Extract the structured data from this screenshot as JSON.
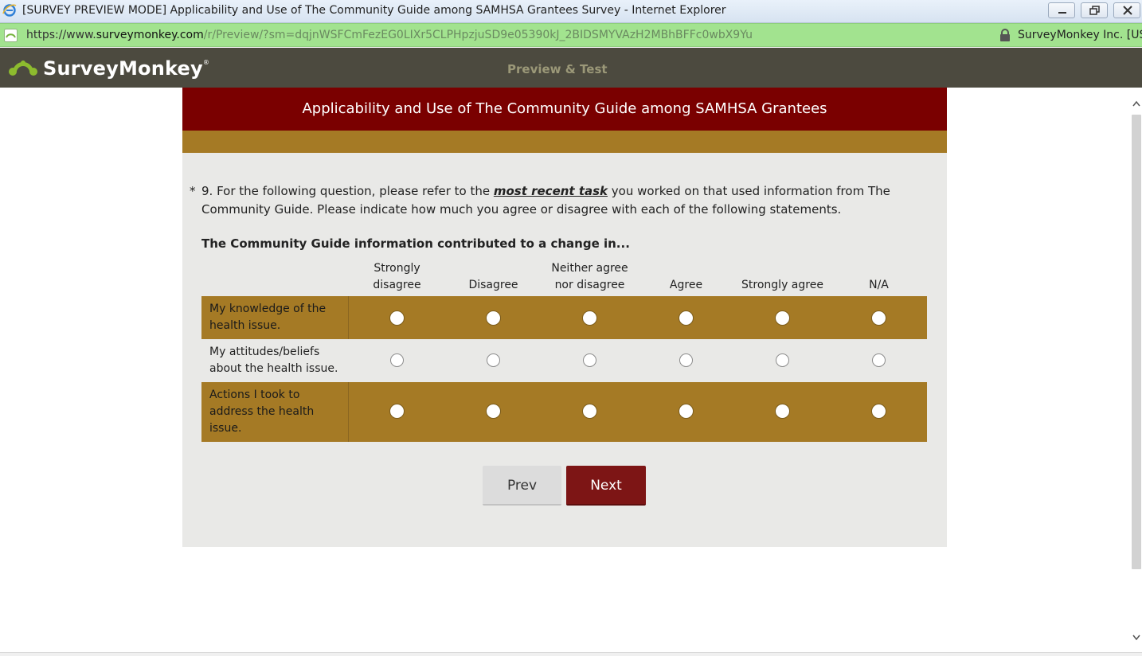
{
  "window": {
    "title": "[SURVEY PREVIEW MODE] Applicability and Use of The Community Guide among SAMHSA Grantees Survey - Internet Explorer"
  },
  "address_bar": {
    "url_scheme": "https://www.",
    "url_host": "surveymonkey.com",
    "url_rest": "/r/Preview/?sm=dqjnWSFCmFezEG0LIXr5CLPHpzjuSD9e05390kJ_2BIDSMYVAzH2MBhBFFc0wbX9Yu",
    "certificate": "SurveyMonkey Inc. [US]"
  },
  "header": {
    "brand": "SurveyMonkey",
    "brand_mark": "®",
    "mode_label": "Preview & Test"
  },
  "survey": {
    "title": "Applicability and Use of The Community Guide among SAMHSA Grantees",
    "question": {
      "required_marker": "*",
      "text_before": "9. For the following question, please refer to the ",
      "emphasis": "most recent task",
      "text_after": " you worked on that used information from The Community Guide. Please indicate how much you agree or disagree with each of the following statements."
    },
    "matrix": {
      "heading": "The Community Guide information contributed to a change in...",
      "columns": [
        "Strongly disagree",
        "Disagree",
        "Neither agree nor disagree",
        "Agree",
        "Strongly agree",
        "N/A"
      ],
      "rows": [
        {
          "label": "My knowledge of the health issue."
        },
        {
          "label": "My attitudes/beliefs about the health issue."
        },
        {
          "label": "Actions I took to address the health issue."
        }
      ]
    },
    "buttons": {
      "prev": "Prev",
      "next": "Next"
    }
  },
  "colors": {
    "title_bg": "#7a0000",
    "accent_band": "#a57a25",
    "next_button": "#7d1515",
    "header_bg": "#4c4a3f",
    "address_bar": "#a2e38f"
  }
}
